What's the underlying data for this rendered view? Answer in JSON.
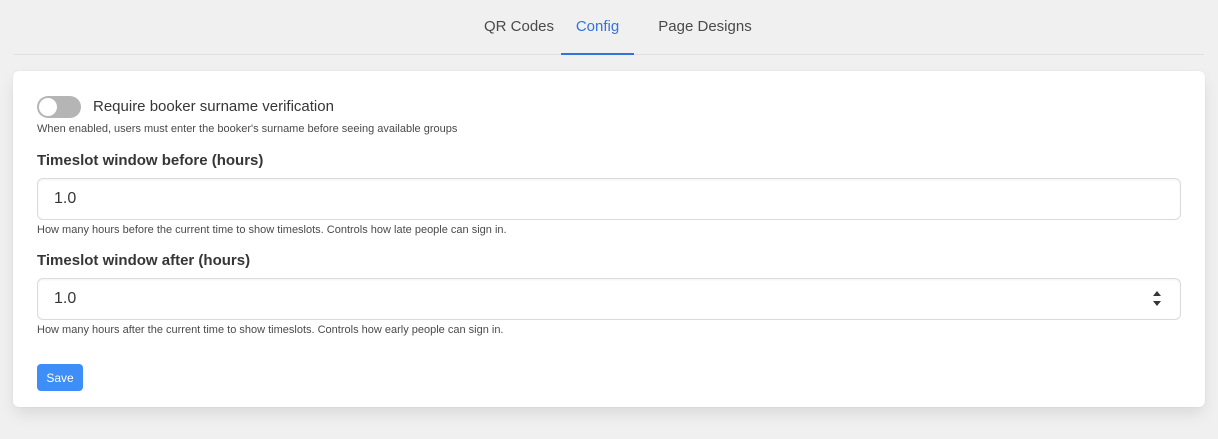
{
  "tabs": [
    {
      "label": "QR Codes",
      "active": false
    },
    {
      "label": "Config",
      "active": true
    },
    {
      "label": "Page Designs",
      "active": false
    }
  ],
  "config": {
    "surname_toggle": {
      "label": "Require booker surname verification",
      "enabled": false,
      "help": "When enabled, users must enter the booker's surname before seeing available groups"
    },
    "window_before": {
      "label": "Timeslot window before (hours)",
      "value": "1.0",
      "help": "How many hours before the current time to show timeslots. Controls how late people can sign in."
    },
    "window_after": {
      "label": "Timeslot window after (hours)",
      "value": "1.0",
      "help": "How many hours after the current time to show timeslots. Controls how early people can sign in."
    },
    "save_label": "Save"
  },
  "colors": {
    "accent": "#3273dc",
    "button": "#3e8ef7",
    "toggle_off": "#b5b5b5"
  }
}
